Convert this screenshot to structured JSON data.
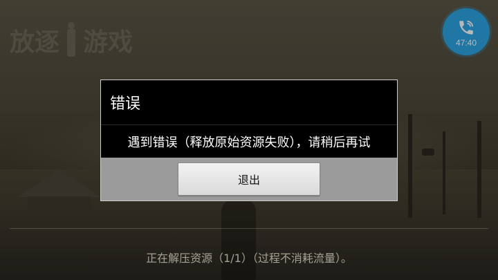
{
  "game": {
    "logo_text": "放逐游戏"
  },
  "call_badge": {
    "icon": "phone-icon",
    "timer": "47:40",
    "color": "#2fa6e3"
  },
  "dialog": {
    "title": "错误",
    "message": "遇到错误（释放原始资源失败），请稍后再试",
    "exit_button_label": "退出"
  },
  "status": {
    "text": "正在解压资源（1/1）（过程不消耗流量）。"
  }
}
